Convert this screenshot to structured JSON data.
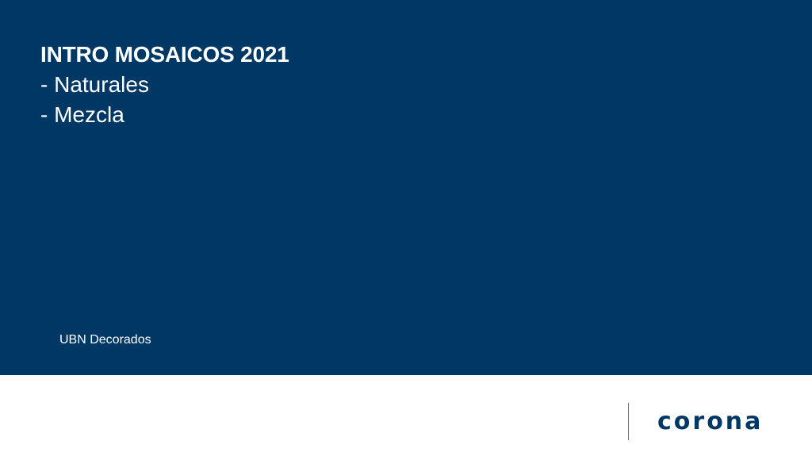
{
  "slide": {
    "heading": "INTRO MOSAICOS 2021",
    "bullets": [
      "- Naturales",
      "- Mezcla"
    ],
    "subtitle": "UBN Decorados"
  },
  "footer": {
    "logo_text": "corona"
  },
  "colors": {
    "banner": "#003865",
    "text_on_banner": "#ffffff",
    "logo": "#003865",
    "divider": "#6f6f6f"
  }
}
